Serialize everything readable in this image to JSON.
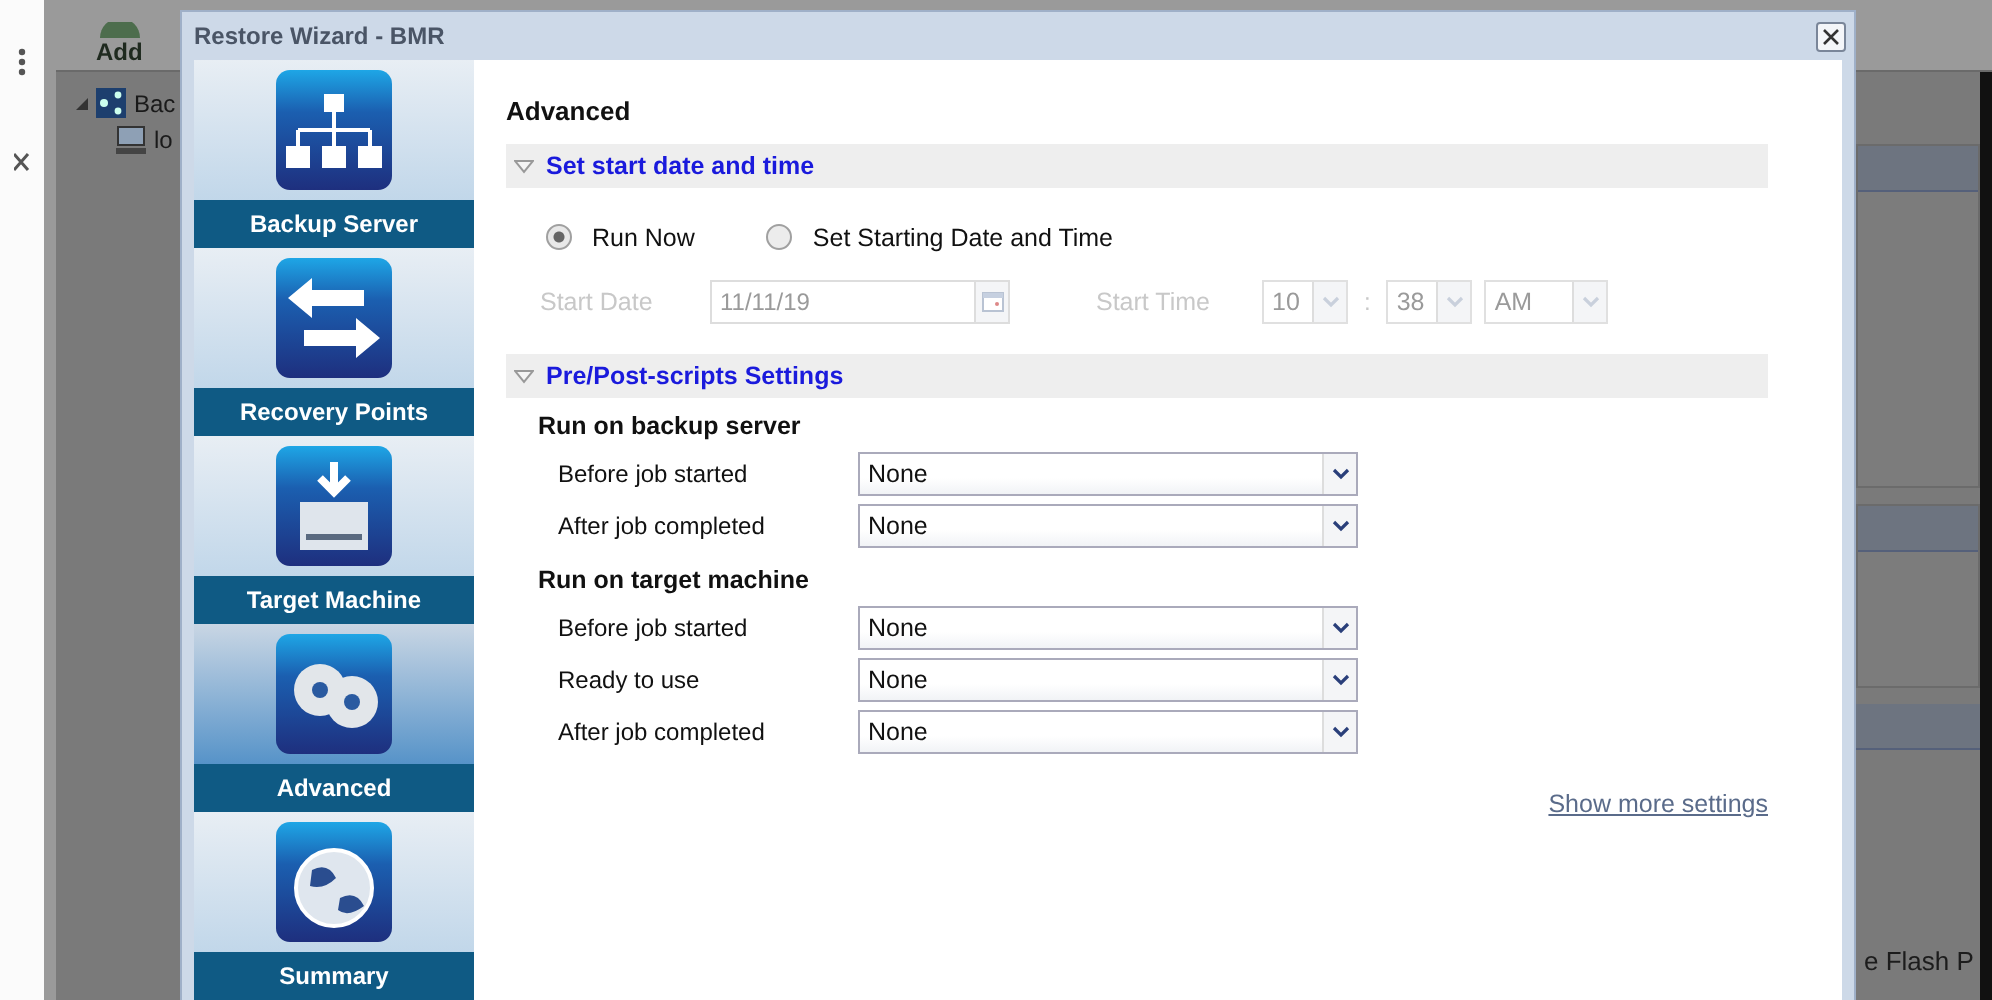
{
  "background": {
    "toolbar_button": "Add",
    "tree": [
      {
        "label": "Bac",
        "children": [
          {
            "label": "lo"
          }
        ]
      }
    ],
    "status_text": "e Flash P"
  },
  "dialog": {
    "title": "Restore Wizard - BMR",
    "steps": [
      {
        "label": "Backup Server",
        "selected": false
      },
      {
        "label": "Recovery Points",
        "selected": false
      },
      {
        "label": "Target Machine",
        "selected": false
      },
      {
        "label": "Advanced",
        "selected": true
      },
      {
        "label": "Summary",
        "selected": false
      }
    ],
    "page_title": "Advanced",
    "schedule": {
      "heading": "Set start date and time",
      "expanded": true,
      "options": [
        {
          "label": "Run Now",
          "selected": true
        },
        {
          "label": "Set Starting Date and Time",
          "selected": false
        }
      ],
      "start_date": {
        "label": "Start Date",
        "value": "11/11/19",
        "disabled": true
      },
      "start_time": {
        "label": "Start Time",
        "hour": "10",
        "separator": ":",
        "minute": "38",
        "period": "AM",
        "disabled": true
      }
    },
    "scripts": {
      "heading": "Pre/Post-scripts Settings",
      "expanded": true,
      "groups": [
        {
          "title": "Run on backup server",
          "rows": [
            {
              "label": "Before job started",
              "value": "None"
            },
            {
              "label": "After job completed",
              "value": "None"
            }
          ]
        },
        {
          "title": "Run on target machine",
          "rows": [
            {
              "label": "Before job started",
              "value": "None"
            },
            {
              "label": "Ready to use",
              "value": "None"
            },
            {
              "label": "After job completed",
              "value": "None"
            }
          ]
        }
      ]
    },
    "link": "Show more settings"
  }
}
